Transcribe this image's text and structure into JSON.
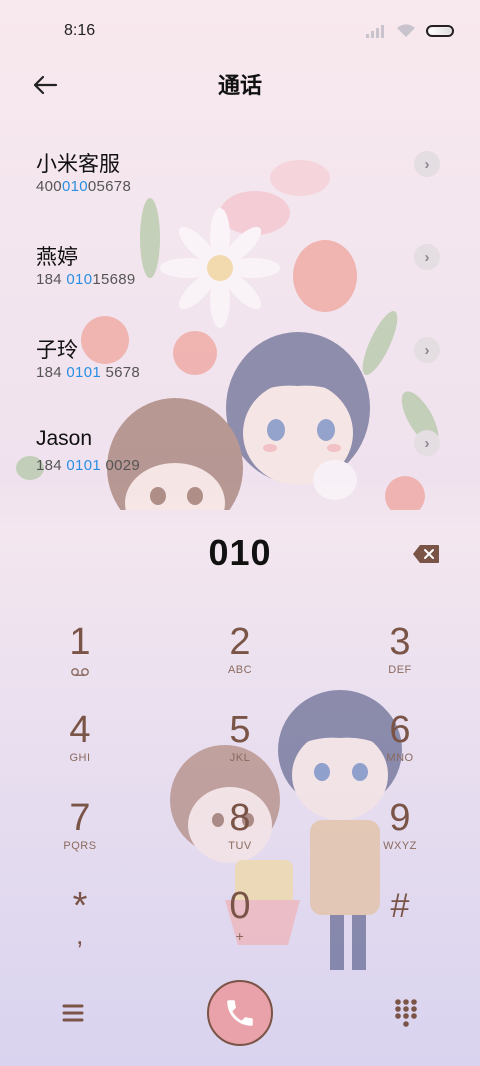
{
  "status": {
    "time": "8:16"
  },
  "header": {
    "title": "通话"
  },
  "contacts": [
    {
      "name": "小米客服",
      "num_pre": "400",
      "num_hl": "010",
      "num_post": "05678"
    },
    {
      "name": "燕婷",
      "num_pre": "184 ",
      "num_hl": "010",
      "num_post": "15689"
    },
    {
      "name": "子玲",
      "num_pre": "184 ",
      "num_hl": "0101",
      "num_post": " 5678"
    },
    {
      "name": "Jason",
      "num_pre": "184 ",
      "num_hl": "0101",
      "num_post": " 0029"
    }
  ],
  "dialer": {
    "input": "010",
    "keys": [
      {
        "digit": "1",
        "letters": ""
      },
      {
        "digit": "2",
        "letters": "ABC"
      },
      {
        "digit": "3",
        "letters": "DEF"
      },
      {
        "digit": "4",
        "letters": "GHI"
      },
      {
        "digit": "5",
        "letters": "JKL"
      },
      {
        "digit": "6",
        "letters": "MNO"
      },
      {
        "digit": "7",
        "letters": "PQRS"
      },
      {
        "digit": "8",
        "letters": "TUV"
      },
      {
        "digit": "9",
        "letters": "WXYZ"
      },
      {
        "digit": "*",
        "letters": ","
      },
      {
        "digit": "0",
        "letters": "+"
      },
      {
        "digit": "#",
        "letters": ""
      }
    ]
  },
  "colors": {
    "accent": "#2a8fe3",
    "key_text": "#7a5446",
    "call_button": "#e9a1aa"
  },
  "icons": {
    "back": "arrow-left-icon",
    "delete": "backspace-icon",
    "menu": "hamburger-menu-icon",
    "call": "phone-icon",
    "keypad": "dialpad-icon",
    "voicemail": "voicemail-icon",
    "detail": "chevron-right-icon"
  }
}
